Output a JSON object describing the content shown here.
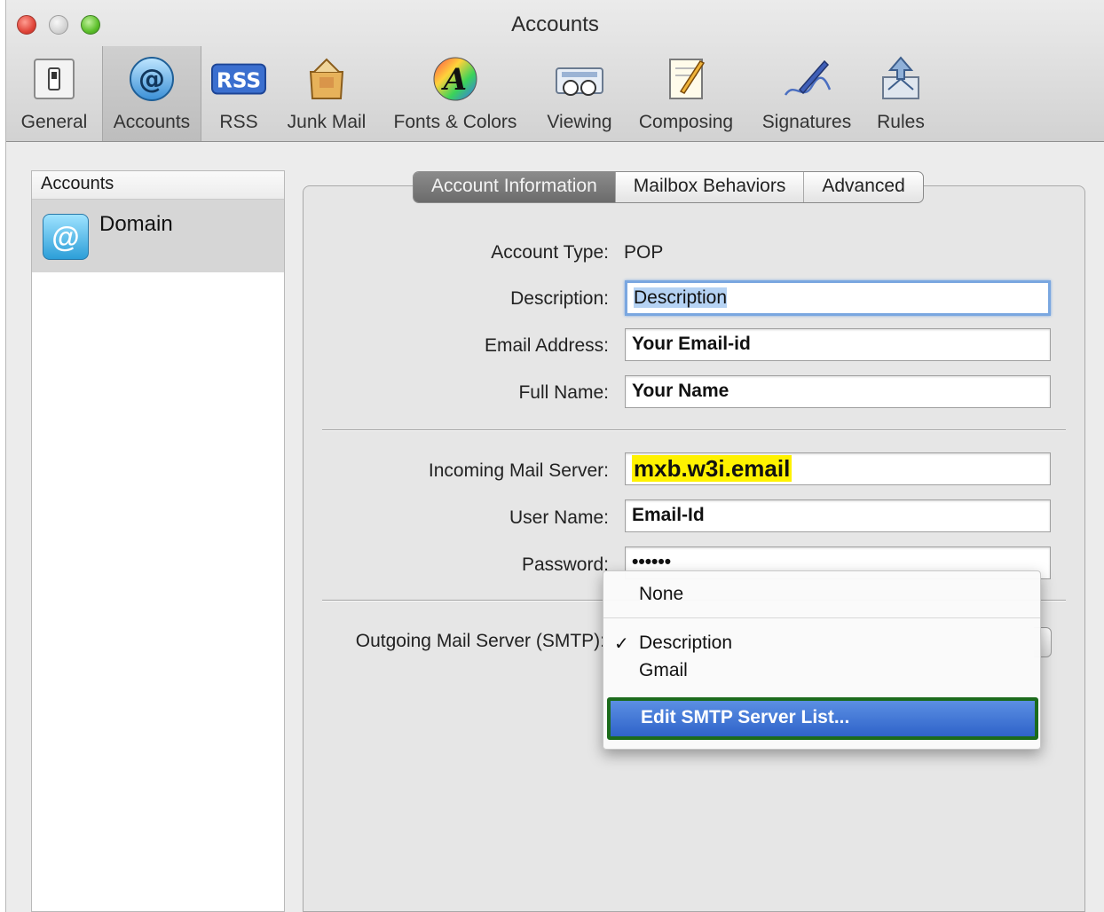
{
  "window": {
    "title": "Accounts"
  },
  "toolbar": {
    "items": [
      {
        "label": "General",
        "icon": "general-switch-icon"
      },
      {
        "label": "Accounts",
        "icon": "at-sign-icon"
      },
      {
        "label": "RSS",
        "icon": "rss-icon"
      },
      {
        "label": "Junk Mail",
        "icon": "junk-mail-icon"
      },
      {
        "label": "Fonts & Colors",
        "icon": "fonts-colors-icon"
      },
      {
        "label": "Viewing",
        "icon": "viewing-icon"
      },
      {
        "label": "Composing",
        "icon": "composing-icon"
      },
      {
        "label": "Signatures",
        "icon": "signatures-icon"
      },
      {
        "label": "Rules",
        "icon": "rules-icon"
      }
    ],
    "rss_text": "RSS",
    "at_text": "@",
    "general_text": "0",
    "fonts_text": "A"
  },
  "sidebar": {
    "header": "Accounts",
    "accounts": [
      {
        "name": "Domain",
        "icon_text": "@"
      }
    ]
  },
  "tabs": [
    {
      "label": "Account Information",
      "active": true
    },
    {
      "label": "Mailbox Behaviors",
      "active": false
    },
    {
      "label": "Advanced",
      "active": false
    }
  ],
  "form": {
    "account_type_label": "Account Type:",
    "account_type_value": "POP",
    "description_label": "Description:",
    "description_value": "Description",
    "email_label": "Email Address:",
    "email_value": "Your Email-id",
    "fullname_label": "Full Name:",
    "fullname_value": "Your Name",
    "incoming_label": "Incoming Mail Server:",
    "incoming_value": "mxb.w3i.email",
    "username_label": "User Name:",
    "username_value": "Email-Id",
    "password_label": "Password:",
    "password_value": "••••••",
    "outgoing_label": "Outgoing Mail Server (SMTP):"
  },
  "smtp_menu": {
    "items": [
      {
        "label": "None",
        "checked": false
      },
      {
        "label": "Description",
        "checked": true
      },
      {
        "label": "Gmail",
        "checked": false
      }
    ],
    "check_mark": "✓",
    "selected_action": "Edit SMTP Server List..."
  },
  "colors": {
    "menu_highlight": "#2f63c9",
    "annotation_border": "#1c6b1c",
    "server_highlight": "#fff200"
  }
}
